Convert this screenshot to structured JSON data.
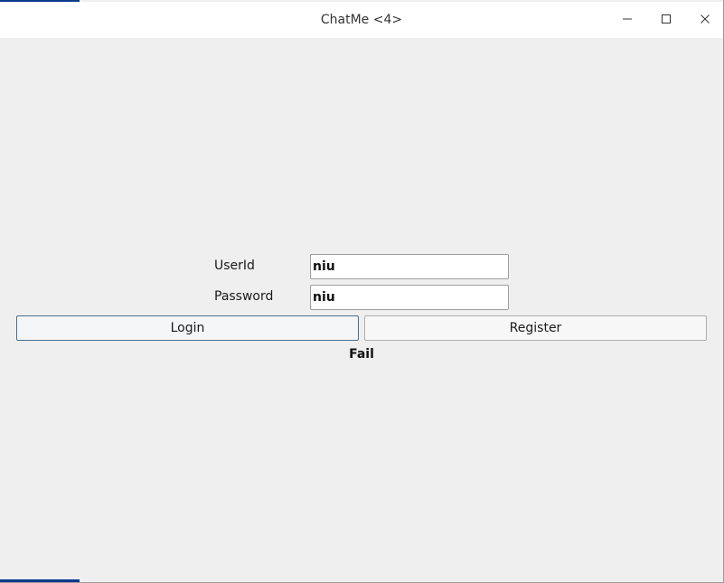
{
  "window": {
    "title": "ChatMe <4>"
  },
  "titlebar_buttons": {
    "minimize_icon": "minimize-icon",
    "maximize_icon": "maximize-icon",
    "close_icon": "close-icon"
  },
  "form": {
    "userid_label": "UserId",
    "userid_value": "niu",
    "password_label": "Password",
    "password_value": "niu"
  },
  "buttons": {
    "login_label": "Login",
    "register_label": "Register"
  },
  "status": {
    "message": "Fail"
  },
  "colors": {
    "window_background": "#efefef",
    "titlebar_background": "#ffffff",
    "accent": "#0a3a8a"
  }
}
